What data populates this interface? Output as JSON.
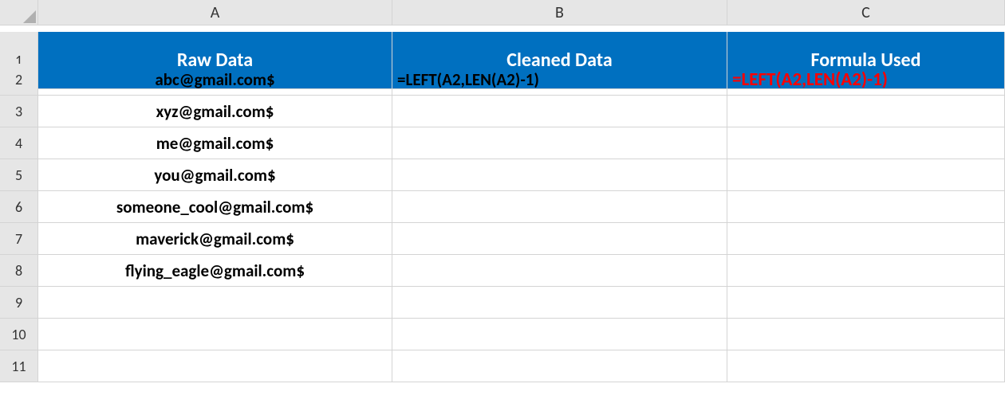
{
  "columns": {
    "A": "A",
    "B": "B",
    "C": "C"
  },
  "row_numbers": [
    "1",
    "2",
    "3",
    "4",
    "5",
    "6",
    "7",
    "8",
    "9",
    "10",
    "11"
  ],
  "headers": {
    "A": "Raw Data",
    "B": "Cleaned Data",
    "C": "Formula Used"
  },
  "rows": [
    {
      "A": "abc@gmail.com$",
      "B": "=LEFT(A2,LEN(A2)-1)",
      "C": "=LEFT(A2,LEN(A2)-1)"
    },
    {
      "A": "xyz@gmail.com$",
      "B": "",
      "C": ""
    },
    {
      "A": "me@gmail.com$",
      "B": "",
      "C": ""
    },
    {
      "A": "you@gmail.com$",
      "B": "",
      "C": ""
    },
    {
      "A": "someone_cool@gmail.com$",
      "B": "",
      "C": ""
    },
    {
      "A": "maverick@gmail.com$",
      "B": "",
      "C": ""
    },
    {
      "A": "flying_eagle@gmail.com$",
      "B": "",
      "C": ""
    },
    {
      "A": "",
      "B": "",
      "C": ""
    },
    {
      "A": "",
      "B": "",
      "C": ""
    },
    {
      "A": "",
      "B": "",
      "C": ""
    }
  ]
}
